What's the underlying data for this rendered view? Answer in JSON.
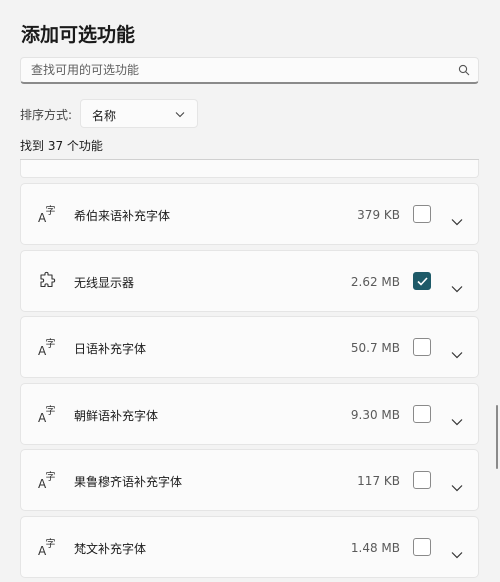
{
  "header": {
    "title": "添加可选功能"
  },
  "search": {
    "placeholder": "查找可用的可选功能"
  },
  "sort": {
    "label": "排序方式:",
    "value": "名称"
  },
  "result_count": "找到 37 个功能",
  "accent_color": "#1e5a68",
  "features": [
    {
      "name": "希伯来语补充字体",
      "size": "379 KB",
      "icon": "font-icon",
      "checked": false
    },
    {
      "name": "无线显示器",
      "size": "2.62 MB",
      "icon": "puzzle-icon",
      "checked": true
    },
    {
      "name": "日语补充字体",
      "size": "50.7 MB",
      "icon": "font-icon",
      "checked": false
    },
    {
      "name": "朝鲜语补充字体",
      "size": "9.30 MB",
      "icon": "font-icon",
      "checked": false
    },
    {
      "name": "果鲁穆齐语补充字体",
      "size": "117 KB",
      "icon": "font-icon",
      "checked": false
    },
    {
      "name": "梵文补充字体",
      "size": "1.48 MB",
      "icon": "font-icon",
      "checked": false
    }
  ]
}
